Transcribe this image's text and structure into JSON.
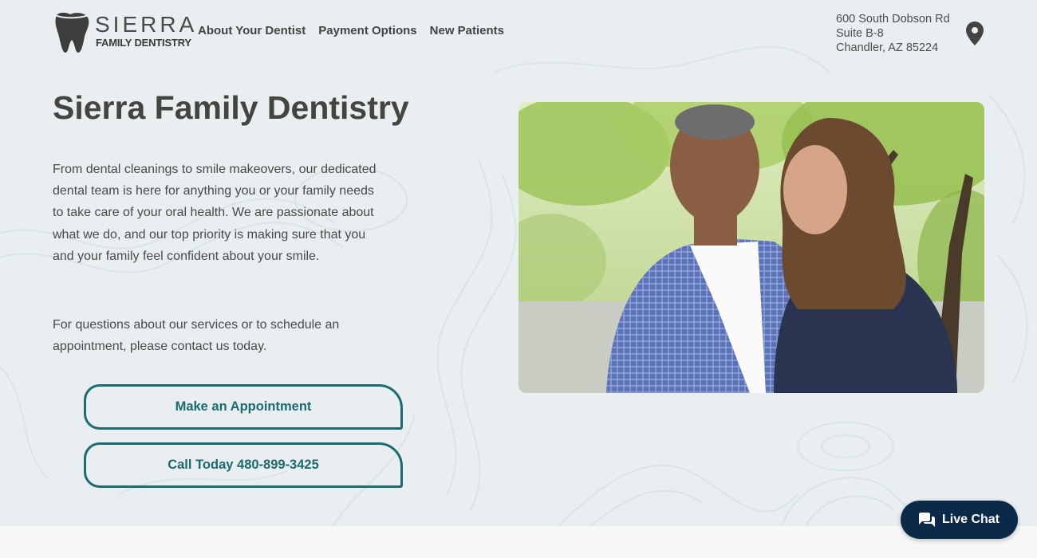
{
  "header": {
    "logo": {
      "word": "SIERRA",
      "sub": "FAMILY DENTISTRY",
      "icon": "tooth-icon"
    },
    "nav": [
      {
        "label": "About Your Dentist"
      },
      {
        "label": "Payment Options"
      },
      {
        "label": "New Patients"
      }
    ],
    "address": {
      "line1": "600 South Dobson Rd",
      "line2": "Suite B-8",
      "line3": "Chandler, AZ 85224",
      "icon": "map-pin-icon"
    }
  },
  "hero": {
    "title": "Sierra Family Dentistry",
    "paragraph1": "From dental cleanings to smile makeovers, our dedicated dental team is here for anything you or your family needs to take care of your oral health. We are passionate about what we do, and our top priority is making sure that you and your family feel confident about your smile.",
    "paragraph2": "For questions about our services or to schedule an appointment, please contact us today.",
    "buttons": [
      {
        "label": "Make an Appointment"
      },
      {
        "label": "Call Today 480-899-3425"
      }
    ]
  },
  "live_chat": {
    "label": "Live Chat",
    "icon": "chat-bubble-icon"
  },
  "colors": {
    "accent": "#1b6b70",
    "hero_bg": "#e9eef0",
    "chat_bg": "#0b2a4a",
    "text": "#454540"
  }
}
